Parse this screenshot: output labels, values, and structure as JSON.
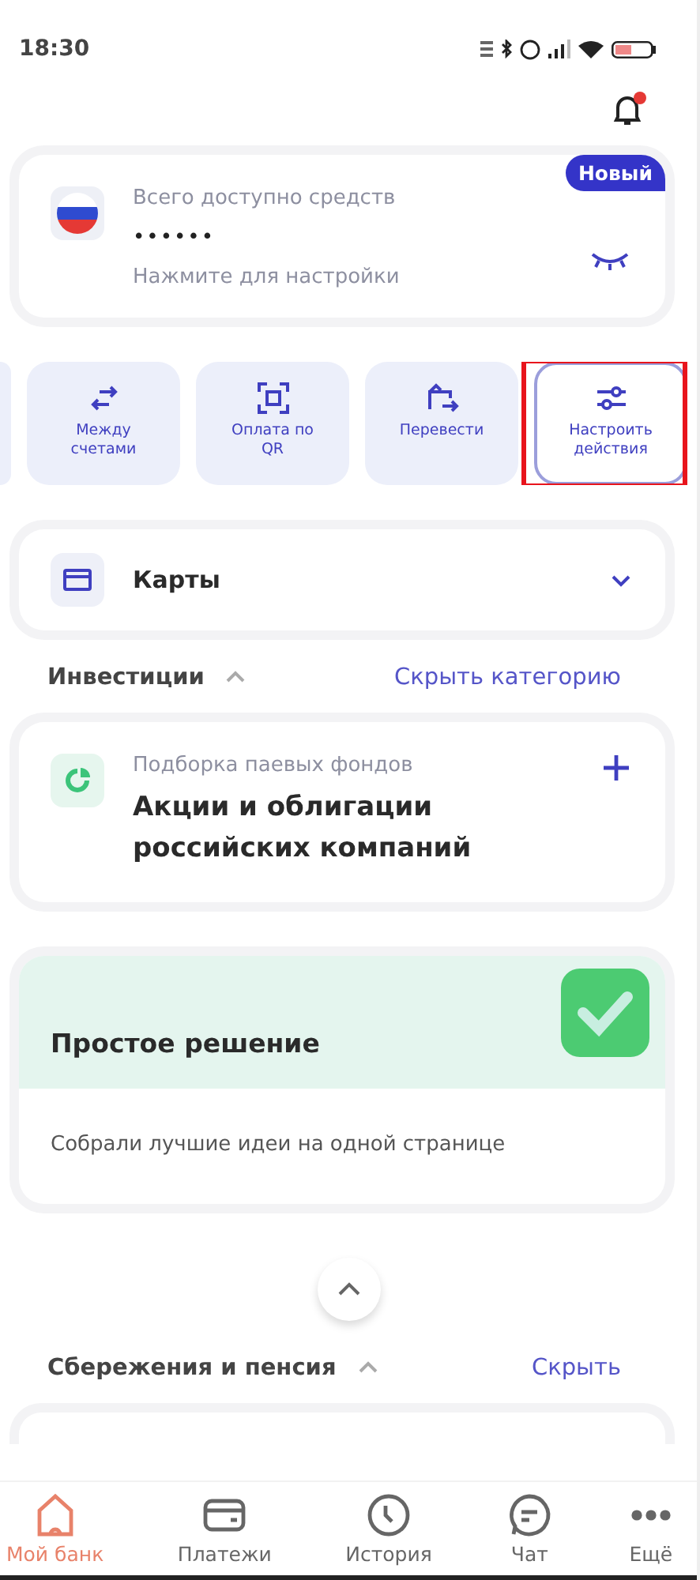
{
  "status_bar": {
    "time": "18:30"
  },
  "notifications": {
    "unread": true
  },
  "balance_card": {
    "title": "Всего доступно средств",
    "amount": "••••••",
    "hint": "Нажмите для настройки",
    "badge": "Новый"
  },
  "quick_actions": [
    {
      "label": "Между счетами",
      "selected": false
    },
    {
      "label": "Оплата по QR",
      "selected": false
    },
    {
      "label": "Перевести",
      "selected": false
    },
    {
      "label": "Настроить действия",
      "selected": true
    }
  ],
  "cards_section": {
    "title": "Карты",
    "expanded": false
  },
  "investments": {
    "title": "Инвестиции",
    "expanded": true,
    "action": "Скрыть категорию",
    "product": {
      "subtitle": "Подборка паевых фондов",
      "title": "Акции и облигации российских компаний"
    }
  },
  "promo": {
    "title": "Простое решение",
    "text": "Собрали лучшие идеи на одной странице"
  },
  "savings": {
    "title": "Сбережения и пенсия",
    "expanded": true,
    "action": "Скрыть"
  },
  "bottom_nav": [
    {
      "label": "Мой банк",
      "selected": true
    },
    {
      "label": "Платежи",
      "selected": false
    },
    {
      "label": "История",
      "selected": false
    },
    {
      "label": "Чат",
      "selected": false
    },
    {
      "label": "Ещё",
      "selected": false
    }
  ]
}
